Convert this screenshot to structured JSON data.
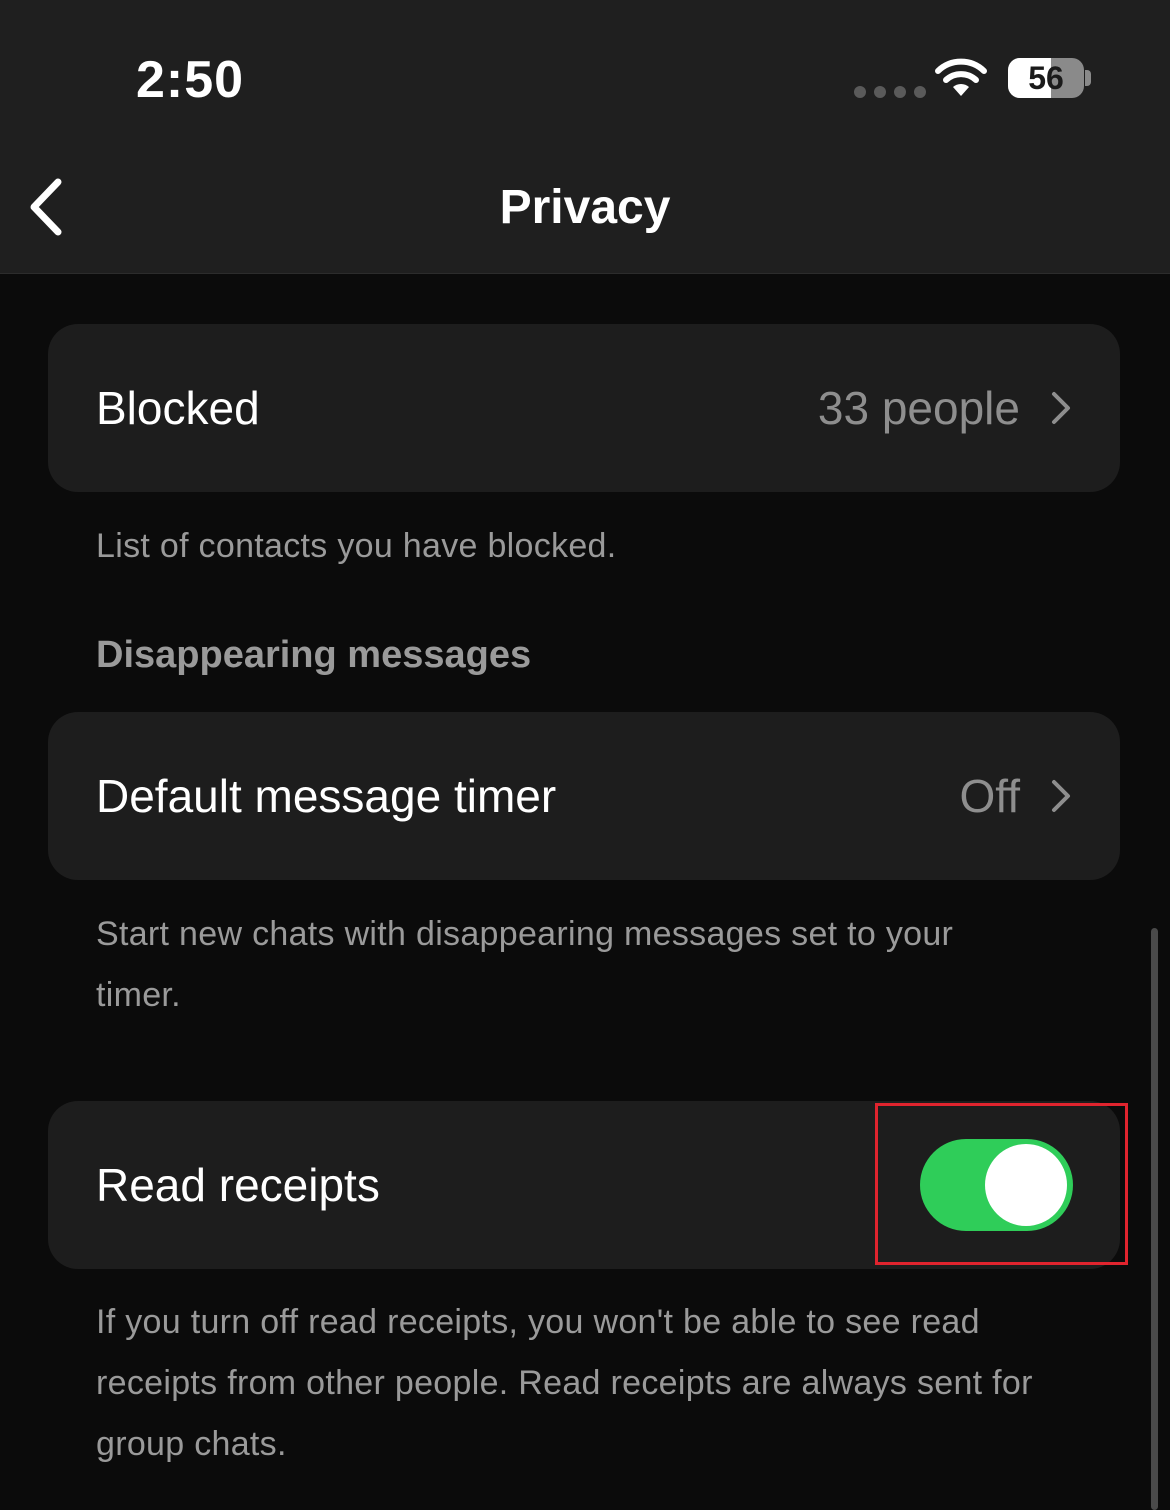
{
  "status_bar": {
    "time": "2:50",
    "battery_level": "56",
    "battery_fraction": 0.56
  },
  "nav": {
    "title": "Privacy",
    "back_icon": "chevron-left-icon"
  },
  "blocked": {
    "label": "Blocked",
    "value": "33 people",
    "footnote": "List of contacts you have blocked."
  },
  "disappearing": {
    "section_header": "Disappearing messages",
    "label": "Default message timer",
    "value": "Off",
    "footnote": "Start new chats with disappearing messages set to your timer."
  },
  "read_receipts": {
    "label": "Read receipts",
    "enabled": true,
    "footnote": "If you turn off read receipts, you won't be able to see read receipts from other people. Read receipts are always sent for group chats."
  },
  "colors": {
    "toggle_on": "#2fcd59",
    "highlight": "#e0242e",
    "background": "#0b0b0b",
    "card": "#1d1d1d"
  }
}
